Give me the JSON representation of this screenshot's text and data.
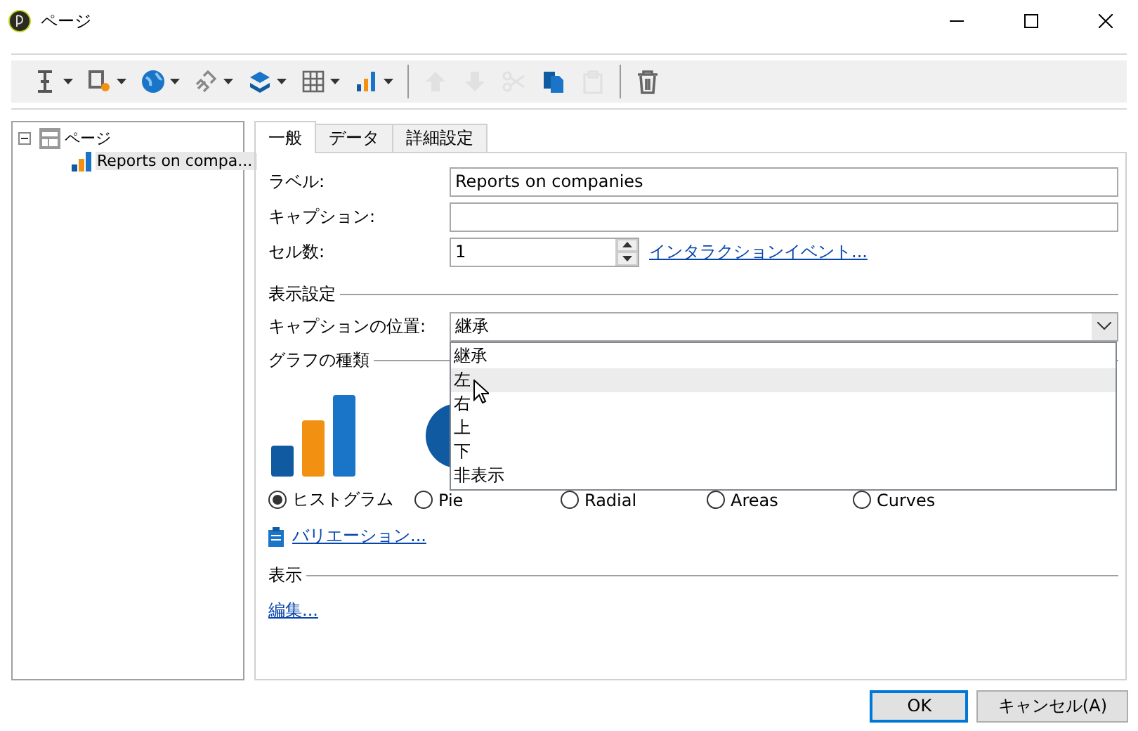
{
  "window": {
    "title": "ページ"
  },
  "toolbar": [
    {
      "dropdown": true,
      "disabled": false
    },
    {
      "dropdown": true,
      "disabled": false
    },
    {
      "dropdown": true,
      "disabled": false
    },
    {
      "dropdown": true,
      "disabled": false
    },
    {
      "dropdown": true,
      "disabled": false
    },
    {
      "dropdown": true,
      "disabled": false
    },
    {
      "dropdown": true,
      "disabled": false
    },
    {
      "dropdown": false,
      "disabled": true
    },
    {
      "dropdown": false,
      "disabled": true
    },
    {
      "dropdown": false,
      "disabled": true
    },
    {
      "dropdown": false,
      "disabled": false
    },
    {
      "dropdown": false,
      "disabled": true
    },
    {
      "dropdown": false,
      "disabled": false
    }
  ],
  "tree": [
    {
      "label": "ページ",
      "expanded": true,
      "children": [
        {
          "label": "Reports on compa...",
          "selected": true
        }
      ]
    }
  ],
  "tabs": [
    {
      "label": "一般",
      "selected": true
    },
    {
      "label": "データ",
      "selected": false
    },
    {
      "label": "詳細設定",
      "selected": false
    }
  ],
  "fields": [
    {
      "label": "ラベル:",
      "kind": "text",
      "value": "Reports on companies"
    },
    {
      "label": "キャプション:",
      "kind": "text"
    },
    {
      "label": "セル数:",
      "kind": "spinner",
      "value": "1",
      "link": "インタラクションイベント..."
    }
  ],
  "display_settings": {
    "title": "表示設定",
    "caption_position": {
      "label": "キャプションの位置:",
      "value": "継承",
      "open": true,
      "options": [
        {
          "label": "継承",
          "highlighted": false
        },
        {
          "label": "左",
          "highlighted": true
        },
        {
          "label": "右",
          "highlighted": false
        },
        {
          "label": "上",
          "highlighted": false
        },
        {
          "label": "下",
          "highlighted": false
        },
        {
          "label": "非表示",
          "highlighted": false
        }
      ]
    }
  },
  "chart_type": {
    "title": "グラフの種類",
    "options": [
      {
        "label": "ヒストグラム",
        "selected": true
      },
      {
        "label": "Pie",
        "selected": false
      },
      {
        "label": "Radial",
        "selected": false
      },
      {
        "label": "Areas",
        "selected": false
      },
      {
        "label": "Curves",
        "selected": false
      }
    ],
    "variation_link": "バリエーション..."
  },
  "display": {
    "title": "表示",
    "edit_link": "編集..."
  },
  "buttons": [
    {
      "label": "OK",
      "default": true
    },
    {
      "label": "キャンセル(A)",
      "default": false
    }
  ]
}
